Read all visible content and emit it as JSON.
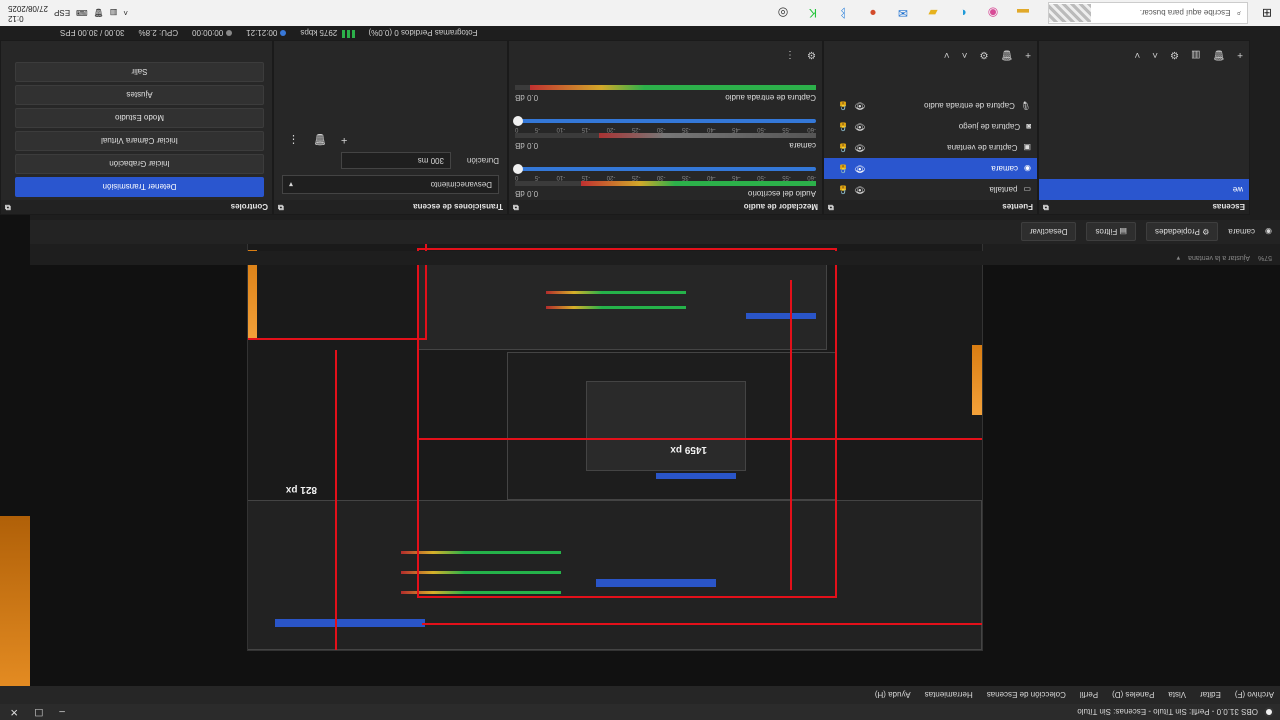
{
  "window": {
    "title": "OBS 31.0.0 - Perfil: Sin Título - Escenas: Sin Título"
  },
  "menu": [
    "Archivo (F)",
    "Editar",
    "Vista",
    "Paneles (D)",
    "Perfil",
    "Colección de Escenas",
    "Herramientas",
    "Ayuda (H)"
  ],
  "zoom": {
    "label": "Ajustar a la ventana",
    "percent": "57%"
  },
  "preview": {
    "dim_label_top": "821 px",
    "dim_label_mid": "1459 px",
    "dim_label_right": "821 px"
  },
  "source_toolbar": {
    "source_name": "camara",
    "properties": "Propiedades",
    "filters": "Filtros",
    "deactivate": "Desactivar"
  },
  "scenes": {
    "title": "Escenas",
    "items": [
      {
        "label": "we",
        "selected": true
      }
    ]
  },
  "sources": {
    "title": "Fuentes",
    "items": [
      {
        "label": "pantalla",
        "selected": false
      },
      {
        "label": "camara",
        "selected": true
      },
      {
        "label": "Captura de ventana",
        "selected": false
      },
      {
        "label": "Captura de juego",
        "selected": false
      },
      {
        "label": "Captura de entrada audio",
        "selected": false
      }
    ]
  },
  "mixer": {
    "title": "Mezclador de audio",
    "channels": [
      {
        "name": "Audio del escritorio",
        "db": "0.0 dB",
        "level": 0.78
      },
      {
        "name": "camara",
        "db": "0.0 dB",
        "level": 0.72
      },
      {
        "name": "Captura de entrada audio",
        "db": "0.0 dB",
        "level": 0.95
      }
    ],
    "ticks": [
      "-60",
      "-55",
      "-50",
      "-45",
      "-40",
      "-35",
      "-30",
      "-25",
      "-20",
      "-15",
      "-10",
      "-5",
      "0"
    ]
  },
  "transitions": {
    "title": "Transiciones de escena",
    "selected": "Desvanecimiento",
    "duration_label": "Duración",
    "duration_value": "300 ms"
  },
  "controls": {
    "title": "Controles",
    "buttons": [
      {
        "label": "Detener Transmisión",
        "active": true
      },
      {
        "label": "Iniciar Grabación",
        "active": false
      },
      {
        "label": "Iniciar Cámara Virtual",
        "active": false
      },
      {
        "label": "Modo Estudio",
        "active": false
      },
      {
        "label": "Ajustes",
        "active": false
      },
      {
        "label": "Salir",
        "active": false
      }
    ]
  },
  "status": {
    "dropped": "Fotogramas Perdidos 0 (0.0%)",
    "bitrate": "2975 kbps",
    "stream_time": "00:21:21",
    "rec_time": "00:00:00",
    "cpu": "CPU: 2.8%",
    "fps": "30.00 / 30.00 FPS"
  },
  "taskbar": {
    "search_placeholder": "Escribe aquí para buscar.",
    "lang": "ESP",
    "time": "0:12",
    "date": "27/08/2025"
  }
}
